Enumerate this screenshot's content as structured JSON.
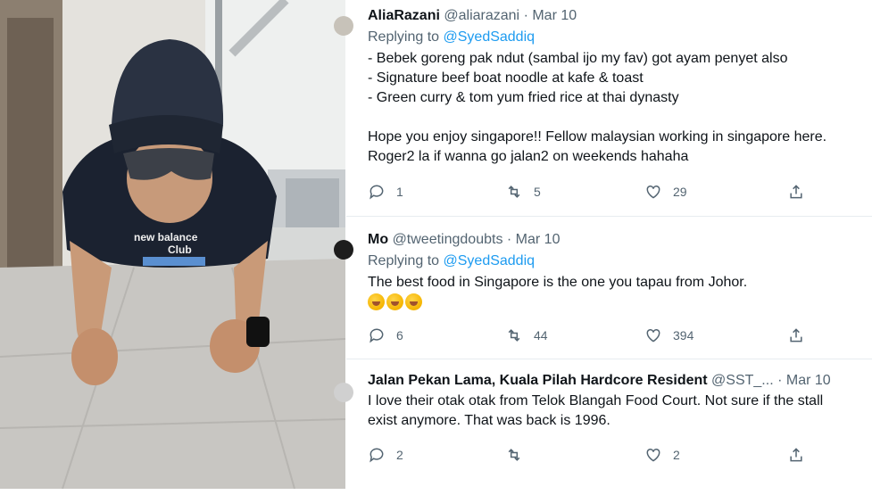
{
  "photo": {
    "shirt_text_line1": "new balance",
    "shirt_text_line2": "Club"
  },
  "tweets": [
    {
      "name": "AliaRazani",
      "handle": "@aliarazani",
      "sep": "·",
      "date": "Mar 10",
      "replying_prefix": "Replying to",
      "replying_to": "@SyedSaddiq",
      "lines": [
        "- Bebek goreng pak ndut (sambal ijo my fav) got ayam penyet also",
        "- Signature beef boat noodle at kafe & toast",
        "- Green curry & tom yum fried rice at thai dynasty",
        "",
        "Hope you enjoy singapore!! Fellow malaysian working in singapore here.",
        "Roger2 la if wanna go jalan2 on weekends hahaha"
      ],
      "replies": "1",
      "retweets": "5",
      "likes": "29"
    },
    {
      "name": "Mo",
      "handle": "@tweetingdoubts",
      "sep": "·",
      "date": "Mar 10",
      "replying_prefix": "Replying to",
      "replying_to": "@SyedSaddiq",
      "lines": [
        "The best food in Singapore is the one you tapau from Johor."
      ],
      "emoji_count": 3,
      "replies": "6",
      "retweets": "44",
      "likes": "394"
    },
    {
      "name": "Jalan Pekan Lama, Kuala Pilah Hardcore Resident",
      "handle": "@SST_...",
      "sep": "·",
      "date": "Mar 10",
      "lines": [
        "I love their otak otak from Telok Blangah Food Court. Not sure if the stall",
        "exist anymore. That was back is 1996."
      ],
      "replies": "2",
      "retweets": "",
      "likes": "2"
    }
  ],
  "icons": {
    "reply": "reply-icon",
    "retweet": "retweet-icon",
    "like": "heart-icon",
    "share": "share-icon"
  },
  "colors": {
    "text": "#0f1419",
    "muted": "#536471",
    "link": "#1d9bf0",
    "divider": "#e7ecf0"
  }
}
